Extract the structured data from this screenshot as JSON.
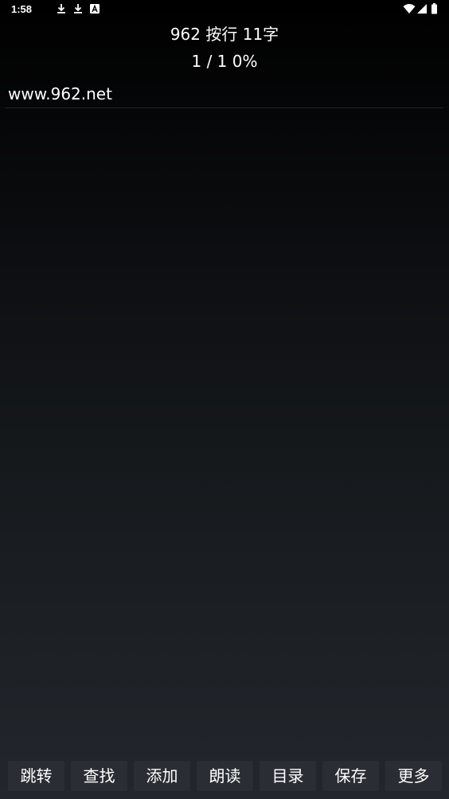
{
  "status_bar": {
    "time": "1:58",
    "icons": [
      "download-icon",
      "download-icon",
      "app-notification-icon",
      "wifi-icon",
      "signal-icon",
      "battery-icon"
    ]
  },
  "header": {
    "title": "962 按行 11字",
    "progress": "1 / 1 0%"
  },
  "content": {
    "lines": [
      "www.962.net"
    ]
  },
  "toolbar": {
    "jump": "跳转",
    "find": "查找",
    "add": "添加",
    "read_aloud": "朗读",
    "contents": "目录",
    "save": "保存",
    "more": "更多"
  },
  "colors": {
    "background_top": "#000000",
    "background_bottom": "#23272d",
    "button_bg": "#2a2e34",
    "text": "#ffffff"
  }
}
